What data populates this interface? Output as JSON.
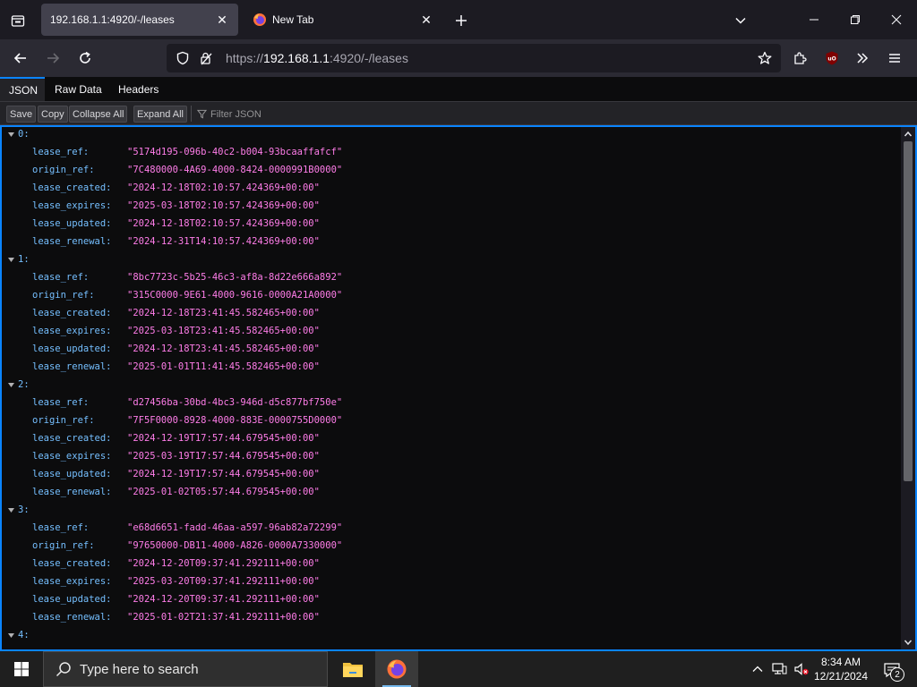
{
  "browser": {
    "tabs": [
      {
        "title": "192.168.1.1:4920/-/leases",
        "active": true
      },
      {
        "title": "New Tab",
        "active": false
      }
    ],
    "url": {
      "scheme": "https://",
      "host": "192.168.1.1",
      "rest": ":4920/-/leases"
    },
    "accent": "#0a84ff"
  },
  "viewer": {
    "tabs": [
      "JSON",
      "Raw Data",
      "Headers"
    ],
    "active_tab": "JSON",
    "toolbar": {
      "save": "Save",
      "copy": "Copy",
      "collapse_all": "Collapse All",
      "expand_all": "Expand All",
      "filter_placeholder": "Filter JSON"
    }
  },
  "json": {
    "items": [
      {
        "index": "0:",
        "fields": [
          {
            "key": "lease_ref:",
            "value": "\"5174d195-096b-40c2-b004-93bcaaffafcf\""
          },
          {
            "key": "origin_ref:",
            "value": "\"7C480000-4A69-4000-8424-0000991B0000\""
          },
          {
            "key": "lease_created:",
            "value": "\"2024-12-18T02:10:57.424369+00:00\""
          },
          {
            "key": "lease_expires:",
            "value": "\"2025-03-18T02:10:57.424369+00:00\""
          },
          {
            "key": "lease_updated:",
            "value": "\"2024-12-18T02:10:57.424369+00:00\""
          },
          {
            "key": "lease_renewal:",
            "value": "\"2024-12-31T14:10:57.424369+00:00\""
          }
        ]
      },
      {
        "index": "1:",
        "fields": [
          {
            "key": "lease_ref:",
            "value": "\"8bc7723c-5b25-46c3-af8a-8d22e666a892\""
          },
          {
            "key": "origin_ref:",
            "value": "\"315C0000-9E61-4000-9616-0000A21A0000\""
          },
          {
            "key": "lease_created:",
            "value": "\"2024-12-18T23:41:45.582465+00:00\""
          },
          {
            "key": "lease_expires:",
            "value": "\"2025-03-18T23:41:45.582465+00:00\""
          },
          {
            "key": "lease_updated:",
            "value": "\"2024-12-18T23:41:45.582465+00:00\""
          },
          {
            "key": "lease_renewal:",
            "value": "\"2025-01-01T11:41:45.582465+00:00\""
          }
        ]
      },
      {
        "index": "2:",
        "fields": [
          {
            "key": "lease_ref:",
            "value": "\"d27456ba-30bd-4bc3-946d-d5c877bf750e\""
          },
          {
            "key": "origin_ref:",
            "value": "\"7F5F0000-8928-4000-883E-0000755D0000\""
          },
          {
            "key": "lease_created:",
            "value": "\"2024-12-19T17:57:44.679545+00:00\""
          },
          {
            "key": "lease_expires:",
            "value": "\"2025-03-19T17:57:44.679545+00:00\""
          },
          {
            "key": "lease_updated:",
            "value": "\"2024-12-19T17:57:44.679545+00:00\""
          },
          {
            "key": "lease_renewal:",
            "value": "\"2025-01-02T05:57:44.679545+00:00\""
          }
        ]
      },
      {
        "index": "3:",
        "fields": [
          {
            "key": "lease_ref:",
            "value": "\"e68d6651-fadd-46aa-a597-96ab82a72299\""
          },
          {
            "key": "origin_ref:",
            "value": "\"97650000-DB11-4000-A826-0000A7330000\""
          },
          {
            "key": "lease_created:",
            "value": "\"2024-12-20T09:37:41.292111+00:00\""
          },
          {
            "key": "lease_expires:",
            "value": "\"2025-03-20T09:37:41.292111+00:00\""
          },
          {
            "key": "lease_updated:",
            "value": "\"2024-12-20T09:37:41.292111+00:00\""
          },
          {
            "key": "lease_renewal:",
            "value": "\"2025-01-02T21:37:41.292111+00:00\""
          }
        ]
      },
      {
        "index": "4:",
        "fields": []
      }
    ],
    "colors": {
      "key": "#75bfff",
      "string": "#ff7de9"
    }
  },
  "taskbar": {
    "search_placeholder": "Type here to search",
    "time": "8:34 AM",
    "date": "12/21/2024",
    "notification_count": "2"
  }
}
